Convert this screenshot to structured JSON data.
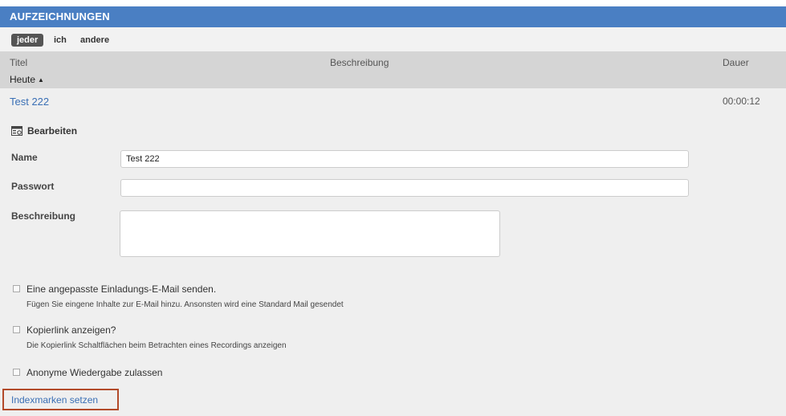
{
  "header": {
    "title": "AUFZEICHNUNGEN"
  },
  "filters": {
    "all": "jeder",
    "me": "ich",
    "others": "andere"
  },
  "columns": {
    "title": "Titel",
    "description": "Beschreibung",
    "duration": "Dauer"
  },
  "group": {
    "label": "Heute"
  },
  "recording": {
    "title": "Test 222",
    "duration": "00:00:12"
  },
  "edit": {
    "heading": "Bearbeiten",
    "name_label": "Name",
    "name_value": "Test 222",
    "password_label": "Passwort",
    "password_value": "",
    "description_label": "Beschreibung",
    "description_value": ""
  },
  "options": {
    "invite_label": "Eine angepasste Einladungs-E-Mail senden.",
    "invite_desc": "Fügen Sie eingene Inhalte zur E-Mail hinzu. Ansonsten wird eine Standard Mail gesendet",
    "copylink_label": "Kopierlink anzeigen?",
    "copylink_desc": "Die Kopierlink Schaltflächen beim Betrachten eines Recordings anzeigen",
    "anonymous_label": "Anonyme Wiedergabe zulassen"
  },
  "index_link": "Indexmarken setzen",
  "colors": {
    "header": "#4a7fc3",
    "link": "#3a6fb5",
    "highlight_border": "#b24a2a"
  }
}
